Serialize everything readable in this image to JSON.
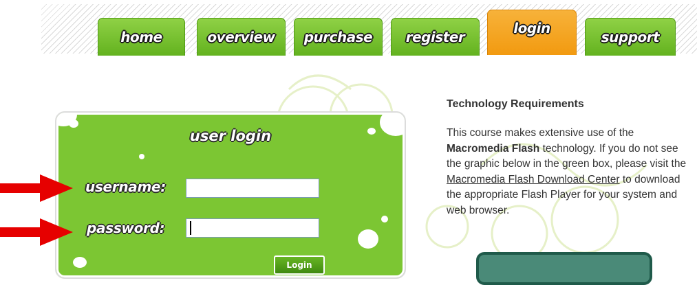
{
  "nav": {
    "tabs": [
      {
        "label": "home",
        "active": false
      },
      {
        "label": "overview",
        "active": false
      },
      {
        "label": "purchase",
        "active": false
      },
      {
        "label": "register",
        "active": false
      },
      {
        "label": "login",
        "active": true
      },
      {
        "label": "support",
        "active": false
      }
    ]
  },
  "login_form": {
    "title": "user login",
    "username_label": "username:",
    "username_value": "",
    "password_label": "password:",
    "password_value": "",
    "submit_label": "Login"
  },
  "requirements": {
    "heading": "Technology Requirements",
    "p_intro": "This course makes extensive use of the",
    "p_flash": "Macromedia Flash",
    "p_mid": "technology. If you do not see the graphic below in the green box, please visit the",
    "p_link": "Macromedia Flash Download Center",
    "p_end": "to download the appropriate Flash Player for your system and web browser."
  },
  "colors": {
    "tab_green": "#6dbb26",
    "tab_active_orange": "#f5a623",
    "login_green": "#7cc633",
    "arrow_red": "#e60000"
  }
}
